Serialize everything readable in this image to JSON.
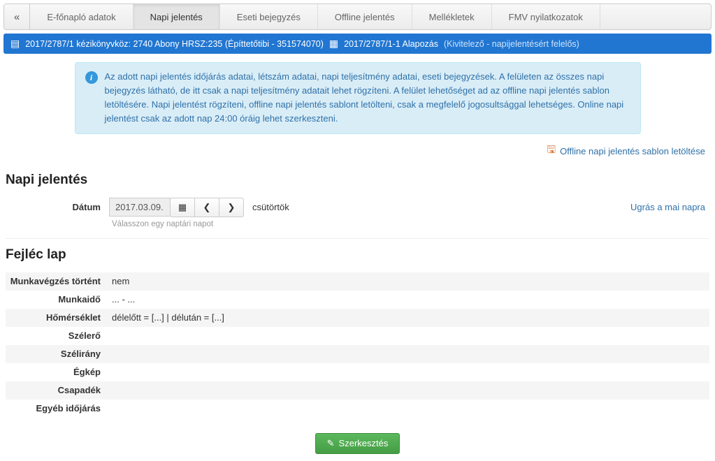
{
  "tabs": {
    "collapse": "«",
    "items": [
      "E-főnapló adatok",
      "Napi jelentés",
      "Eseti bejegyzés",
      "Offline jelentés",
      "Mellékletek",
      "FMV nyilatkozatok"
    ],
    "active_index": 1
  },
  "breadcrumb": {
    "book_icon": "▤",
    "primary": "2017/2787/1 kézikönyvköz: 2740 Abony HRSZ:235 (Építtetőtibi - 351574070)",
    "list_icon": "▦",
    "secondary_main": "2017/2787/1-1 Alapozás",
    "secondary_role": "(Kivitelező - napijelentésért felelős)"
  },
  "info": {
    "text": "Az adott napi jelentés időjárás adatai, létszám adatai, napi teljesítmény adatai, eseti bejegyzések. A felületen az összes napi bejegyzés látható, de itt csak a napi teljesítmény adatait lehet rögzíteni. A felület lehetőséget ad az offline napi jelentés sablon letöltésére. Napi jelentést rögzíteni, offline napi jelentés sablont letölteni, csak a megfelelő jogosultsággal lehetséges. Online napi jelentést csak az adott nap 24:00 óráig lehet szerkeszteni."
  },
  "download": {
    "label": "Offline napi jelentés sablon letöltése"
  },
  "section1_title": "Napi jelentés",
  "date": {
    "label": "Dátum",
    "value": "2017.03.09.",
    "cal_icon": "▦",
    "prev": "❮",
    "next": "❯",
    "dow": "csütörtök",
    "today_link": "Ugrás a mai napra",
    "hint": "Válasszon egy naptári napot"
  },
  "section2_title": "Fejléc lap",
  "fields": [
    {
      "label": "Munkavégzés történt",
      "value": "nem"
    },
    {
      "label": "Munkaidő",
      "value": "... - ..."
    },
    {
      "label": "Hőmérséklet",
      "value": "délelőtt = [...]     |     délután = [...]"
    },
    {
      "label": "Szélerő",
      "value": ""
    },
    {
      "label": "Szélirány",
      "value": ""
    },
    {
      "label": "Égkép",
      "value": ""
    },
    {
      "label": "Csapadék",
      "value": ""
    },
    {
      "label": "Egyéb időjárás",
      "value": ""
    }
  ],
  "edit_button": "Szerkesztés"
}
